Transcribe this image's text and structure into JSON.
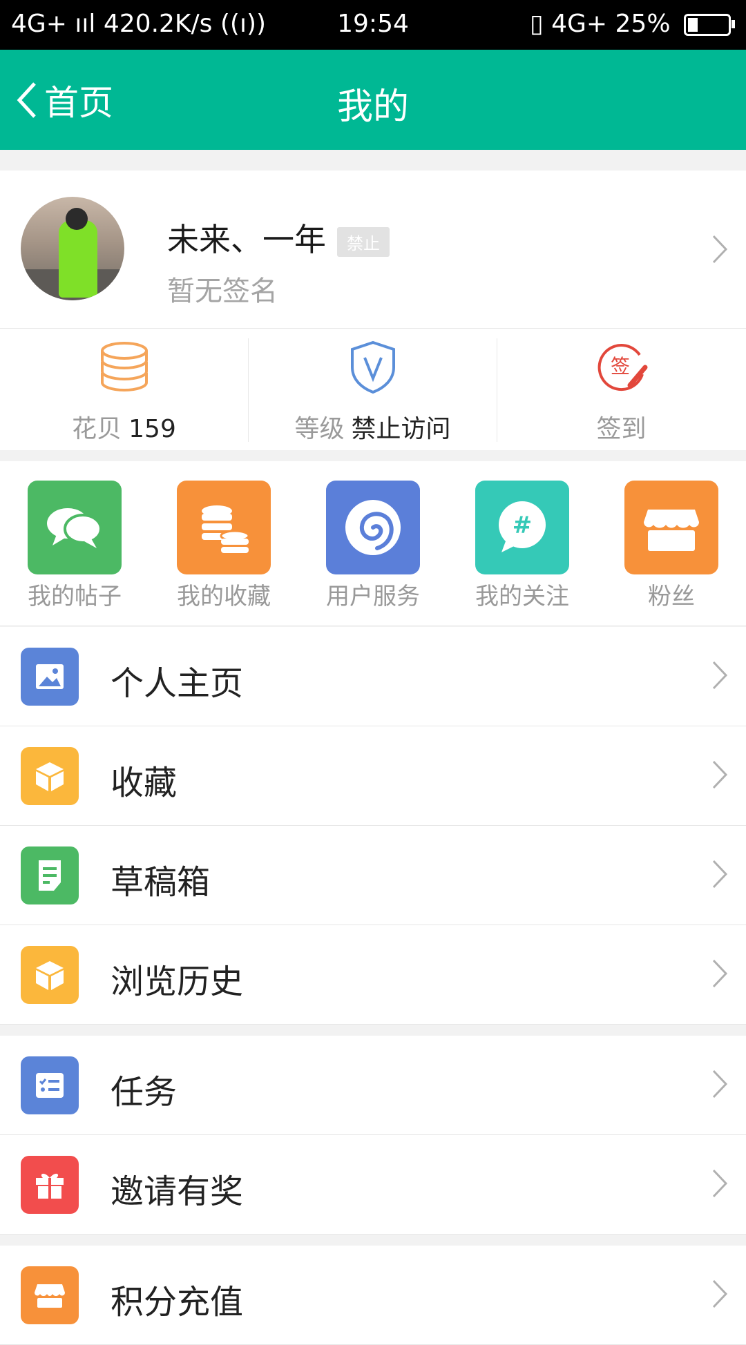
{
  "status_bar": {
    "left": "4G+ ııl 420.2K/s ((ı))",
    "time": "19:54",
    "right": "▯ 4G+ 25%",
    "battery_level": 0.25
  },
  "nav": {
    "back_label": "首页",
    "title": "我的"
  },
  "profile": {
    "name": "未来、一年",
    "badge": "禁止",
    "signature": "暂无签名"
  },
  "stats": {
    "coins_label": "花贝",
    "coins_value": "159",
    "level_label": "等级",
    "level_value": "禁止访问",
    "checkin_label": "签到"
  },
  "quick_actions": [
    {
      "label": "我的帖子",
      "color": "#4cb964",
      "icon": "chat-bubbles-icon"
    },
    {
      "label": "我的收藏",
      "color": "#f7913a",
      "icon": "coins-icon"
    },
    {
      "label": "用户服务",
      "color": "#5b7fd9",
      "icon": "spiral-icon"
    },
    {
      "label": "我的关注",
      "color": "#35c9b7",
      "icon": "hashtag-bubble-icon"
    },
    {
      "label": "粉丝",
      "color": "#f7913a",
      "icon": "shop-icon"
    }
  ],
  "menu": [
    {
      "label": "个人主页",
      "color": "#5b84d8",
      "icon": "image-icon"
    },
    {
      "label": "收藏",
      "color": "#fbb73c",
      "icon": "box-icon"
    },
    {
      "label": "草稿箱",
      "color": "#4cb964",
      "icon": "document-icon"
    },
    {
      "label": "浏览历史",
      "color": "#fbb73c",
      "icon": "box-icon"
    },
    {
      "label": "任务",
      "color": "#5b84d8",
      "icon": "checklist-icon"
    },
    {
      "label": "邀请有奖",
      "color": "#f24d4d",
      "icon": "gift-icon"
    },
    {
      "label": "积分充值",
      "color": "#f7913a",
      "icon": "shop-icon"
    }
  ],
  "colors": {
    "nav_green": "#00b894",
    "stat_orange": "#f5a55a",
    "stat_blue": "#5b8fd9",
    "stat_red": "#e2473b"
  }
}
